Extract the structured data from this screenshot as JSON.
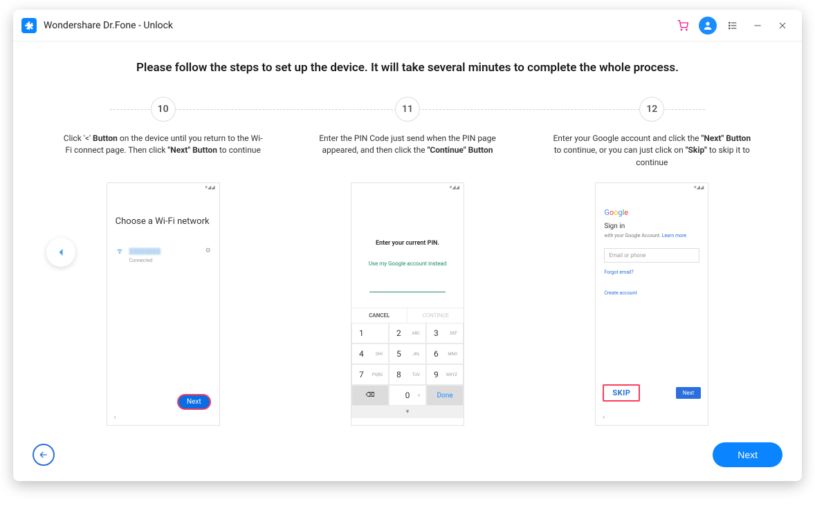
{
  "title": "Wondershare Dr.Fone - Unlock",
  "heading": "Please follow the steps to set up the device. It will take several minutes to complete the whole process.",
  "steps": [
    {
      "num": "10",
      "desc_pre": "Click '<' ",
      "desc_bold1": "Button",
      "desc_mid": " on the device until you return to the Wi-Fi connect page. Then click ",
      "desc_bold2": "\"Next\" Button",
      "desc_post": " to continue"
    },
    {
      "num": "11",
      "desc_pre": "Enter the PIN Code just send when the PIN page appeared, and then click the ",
      "desc_bold1": "\"Continue\" Button",
      "desc_mid": "",
      "desc_bold2": "",
      "desc_post": ""
    },
    {
      "num": "12",
      "desc_pre": "Enter your Google account and click the ",
      "desc_bold1": "\"Next\" Button",
      "desc_mid": " to continue, or you can just click on ",
      "desc_bold2": "\"Skip\"",
      "desc_post": " to skip it to continue"
    }
  ],
  "phone1": {
    "title": "Choose a Wi-Fi network",
    "connected": "Connected",
    "next": "Next"
  },
  "phone2": {
    "header": "Enter your current PIN.",
    "link": "Use my Google account instead",
    "cancel": "CANCEL",
    "cont": "CONTINUE",
    "keys": {
      "k1": "1",
      "k2": "2",
      "k2l": "ABC",
      "k3": "3",
      "k3l": "DEF",
      "k4": "4",
      "k4l": "GHI",
      "k5": "5",
      "k5l": "JKL",
      "k6": "6",
      "k6l": "MNO",
      "k7": "7",
      "k7l": "PQRS",
      "k8": "8",
      "k8l": "TUV",
      "k9": "9",
      "k9l": "WXYZ",
      "k0": "0",
      "kplus": "+",
      "done": "Done"
    }
  },
  "phone3": {
    "signin": "Sign in",
    "sub_pre": "with your Google Account. ",
    "learn": "Learn more",
    "placeholder": "Email or phone",
    "forgot": "Forgot email?",
    "create": "Create account",
    "skip": "SKIP",
    "next": "Next"
  },
  "footer": {
    "next": "Next"
  }
}
